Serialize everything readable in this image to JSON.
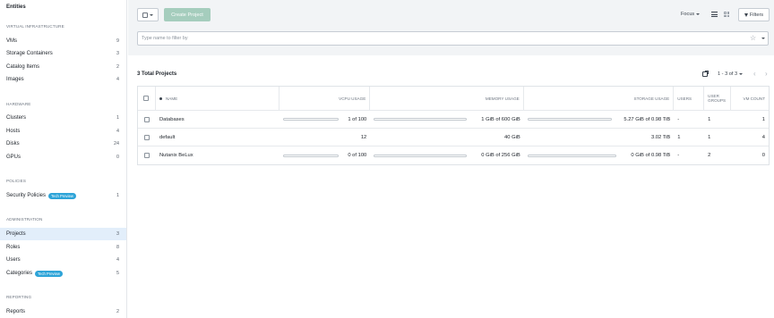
{
  "sidebar": {
    "title": "Entities",
    "sections": [
      {
        "heading": "VIRTUAL INFRASTRUCTURE",
        "items": [
          {
            "label": "VMs",
            "count": "9"
          },
          {
            "label": "Storage Containers",
            "count": "3"
          },
          {
            "label": "Catalog Items",
            "count": "2"
          },
          {
            "label": "Images",
            "count": "4"
          }
        ]
      },
      {
        "heading": "HARDWARE",
        "items": [
          {
            "label": "Clusters",
            "count": "1"
          },
          {
            "label": "Hosts",
            "count": "4"
          },
          {
            "label": "Disks",
            "count": "24"
          },
          {
            "label": "GPUs",
            "count": "0"
          }
        ]
      },
      {
        "heading": "POLICIES",
        "items": [
          {
            "label": "Security Policies",
            "badge": "Tech Preview",
            "count": "1"
          }
        ]
      },
      {
        "heading": "ADMINISTRATION",
        "items": [
          {
            "label": "Projects",
            "count": "3",
            "active": true
          },
          {
            "label": "Roles",
            "count": "8"
          },
          {
            "label": "Users",
            "count": "4"
          },
          {
            "label": "Categories",
            "badge": "Tech Preview",
            "count": "5"
          }
        ]
      },
      {
        "heading": "REPORTING",
        "items": [
          {
            "label": "Reports",
            "count": "2"
          }
        ]
      }
    ]
  },
  "toolbar": {
    "create_label": "Create Project",
    "focus_label": "Focus",
    "filters_label": "Filters",
    "filter_placeholder": "Type name to filter by"
  },
  "table": {
    "total_label": "3 Total Projects",
    "pagination": "1 - 3 of 3",
    "columns": {
      "name": "NAME",
      "vcpu": "VCPU USAGE",
      "memory": "MEMORY USAGE",
      "storage": "STORAGE USAGE",
      "users": "USERS",
      "user_groups": "USER GROUPS",
      "vm_count": "VM COUNT"
    },
    "rows": [
      {
        "name": "Databases",
        "vcpu": "1 of 100",
        "memory": "1 GiB of 600 GiB",
        "storage": "5.27 GiB of 0.98 TiB",
        "users": "-",
        "user_groups": "1",
        "vm_count": "1"
      },
      {
        "name": "default",
        "vcpu": "12",
        "memory": "40 GiB",
        "storage": "3.02 TiB",
        "users": "1",
        "user_groups": "1",
        "vm_count": "4"
      },
      {
        "name": "Nutanix BeLux",
        "vcpu": "0 of 100",
        "memory": "0 GiB of 256 GiB",
        "storage": "0 GiB of 0.98 TiB",
        "users": "-",
        "user_groups": "2",
        "vm_count": "0"
      }
    ]
  },
  "colors": {
    "accent": "#2ea4d8",
    "active_row": "#e2eefa",
    "create_button": "#a5cdbd"
  }
}
